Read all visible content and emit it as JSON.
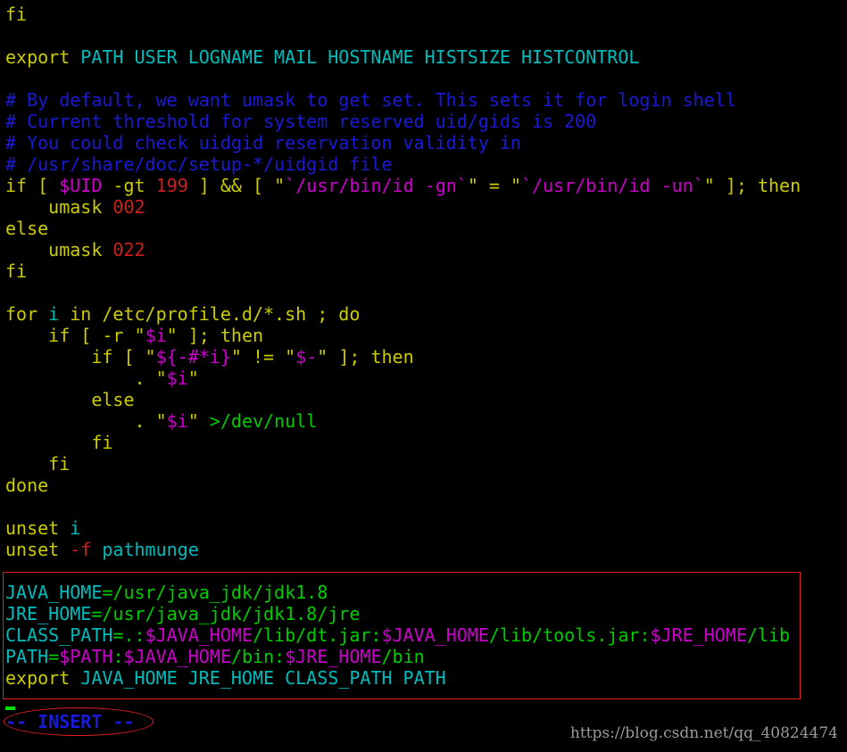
{
  "editor": {
    "lines": [
      [
        {
          "t": "fi",
          "c": "kw"
        }
      ],
      [],
      [
        {
          "t": "export ",
          "c": "kw"
        },
        {
          "t": "PATH USER LOGNAME MAIL HOSTNAME HISTSIZE HISTCONTROL",
          "c": "var"
        }
      ],
      [],
      [
        {
          "t": "# By default, we want umask to get set. This sets it for login shell",
          "c": "cmt"
        }
      ],
      [
        {
          "t": "# Current threshold for system reserved uid/gids is 200",
          "c": "cmt"
        }
      ],
      [
        {
          "t": "# You could check uidgid reservation validity in",
          "c": "cmt"
        }
      ],
      [
        {
          "t": "# /usr/share/doc/setup-*/uidgid file",
          "c": "cmt"
        }
      ],
      [
        {
          "t": "if ",
          "c": "kw"
        },
        {
          "t": "[ ",
          "c": "kw"
        },
        {
          "t": "$UID",
          "c": "sub"
        },
        {
          "t": " -gt ",
          "c": "kw"
        },
        {
          "t": "199",
          "c": "num"
        },
        {
          "t": " ] ",
          "c": "kw"
        },
        {
          "t": "&&",
          "c": "kw"
        },
        {
          "t": " [ ",
          "c": "kw"
        },
        {
          "t": "\"",
          "c": "kw"
        },
        {
          "t": "`/usr/bin/id -gn`",
          "c": "sub"
        },
        {
          "t": "\"",
          "c": "kw"
        },
        {
          "t": " = ",
          "c": "kw"
        },
        {
          "t": "\"",
          "c": "kw"
        },
        {
          "t": "`/usr/bin/id -un`",
          "c": "sub"
        },
        {
          "t": "\"",
          "c": "kw"
        },
        {
          "t": " ]; then",
          "c": "kw"
        }
      ],
      [
        {
          "t": "    umask ",
          "c": "kw"
        },
        {
          "t": "002",
          "c": "num"
        }
      ],
      [
        {
          "t": "else",
          "c": "kw"
        }
      ],
      [
        {
          "t": "    umask ",
          "c": "kw"
        },
        {
          "t": "022",
          "c": "num"
        }
      ],
      [
        {
          "t": "fi",
          "c": "kw"
        }
      ],
      [],
      [
        {
          "t": "for ",
          "c": "kw"
        },
        {
          "t": "i",
          "c": "var"
        },
        {
          "t": " in /etc/profile.d/*.sh ; do",
          "c": "kw"
        }
      ],
      [
        {
          "t": "    if ",
          "c": "kw"
        },
        {
          "t": "[ -r ",
          "c": "kw"
        },
        {
          "t": "\"",
          "c": "kw"
        },
        {
          "t": "$i",
          "c": "sub"
        },
        {
          "t": "\"",
          "c": "kw"
        },
        {
          "t": " ]; then",
          "c": "kw"
        }
      ],
      [
        {
          "t": "        if ",
          "c": "kw"
        },
        {
          "t": "[ ",
          "c": "kw"
        },
        {
          "t": "\"",
          "c": "kw"
        },
        {
          "t": "${-#*i}",
          "c": "sub"
        },
        {
          "t": "\"",
          "c": "kw"
        },
        {
          "t": " != ",
          "c": "kw"
        },
        {
          "t": "\"",
          "c": "kw"
        },
        {
          "t": "$-",
          "c": "sub"
        },
        {
          "t": "\"",
          "c": "kw"
        },
        {
          "t": " ]; then",
          "c": "kw"
        }
      ],
      [
        {
          "t": "            . ",
          "c": "kw"
        },
        {
          "t": "\"",
          "c": "kw"
        },
        {
          "t": "$i",
          "c": "sub"
        },
        {
          "t": "\"",
          "c": "kw"
        }
      ],
      [
        {
          "t": "        else",
          "c": "kw"
        }
      ],
      [
        {
          "t": "            . ",
          "c": "kw"
        },
        {
          "t": "\"",
          "c": "kw"
        },
        {
          "t": "$i",
          "c": "sub"
        },
        {
          "t": "\"",
          "c": "kw"
        },
        {
          "t": " >/dev/null",
          "c": "cmd"
        }
      ],
      [
        {
          "t": "        fi",
          "c": "kw"
        }
      ],
      [
        {
          "t": "    fi",
          "c": "kw"
        }
      ],
      [
        {
          "t": "done",
          "c": "kw"
        }
      ],
      [],
      [
        {
          "t": "unset ",
          "c": "kw"
        },
        {
          "t": "i",
          "c": "var"
        }
      ],
      [
        {
          "t": "unset ",
          "c": "kw"
        },
        {
          "t": "-f",
          "c": "flag"
        },
        {
          "t": " pathmunge",
          "c": "id"
        }
      ],
      [],
      [
        {
          "t": "JAVA_HOME",
          "c": "var"
        },
        {
          "t": "=/usr/java_jdk/jdk1.8",
          "c": "cmd"
        }
      ],
      [
        {
          "t": "JRE_HOME",
          "c": "var"
        },
        {
          "t": "=/usr/java_jdk/jdk1.8/jre",
          "c": "cmd"
        }
      ],
      [
        {
          "t": "CLASS_PATH",
          "c": "var"
        },
        {
          "t": "=.:",
          "c": "cmd"
        },
        {
          "t": "$JAVA_HOME",
          "c": "sub"
        },
        {
          "t": "/lib/dt.jar:",
          "c": "cmd"
        },
        {
          "t": "$JAVA_HOME",
          "c": "sub"
        },
        {
          "t": "/lib/tools.jar:",
          "c": "cmd"
        },
        {
          "t": "$JRE_HOME",
          "c": "sub"
        },
        {
          "t": "/lib",
          "c": "cmd"
        }
      ],
      [
        {
          "t": "PATH",
          "c": "var"
        },
        {
          "t": "=",
          "c": "cmd"
        },
        {
          "t": "$PATH",
          "c": "sub"
        },
        {
          "t": ":",
          "c": "cmd"
        },
        {
          "t": "$JAVA_HOME",
          "c": "sub"
        },
        {
          "t": "/bin:",
          "c": "cmd"
        },
        {
          "t": "$JRE_HOME",
          "c": "sub"
        },
        {
          "t": "/bin",
          "c": "cmd"
        }
      ],
      [
        {
          "t": "export ",
          "c": "kw"
        },
        {
          "t": "JAVA_HOME JRE_HOME CLASS_PATH PATH",
          "c": "var"
        }
      ]
    ]
  },
  "statusbar": {
    "mode": "-- INSERT --"
  },
  "watermark": {
    "text": "https://blog.csdn.net/qq_40824474"
  },
  "colors": {
    "background": "#000000",
    "keyword": "#cccc00",
    "variable": "#00bcbc",
    "comment": "#1a1ad6",
    "number": "#cc1f1f",
    "substitution": "#cc00cc",
    "path": "#00cc00",
    "highlight_box": "#e02020"
  }
}
